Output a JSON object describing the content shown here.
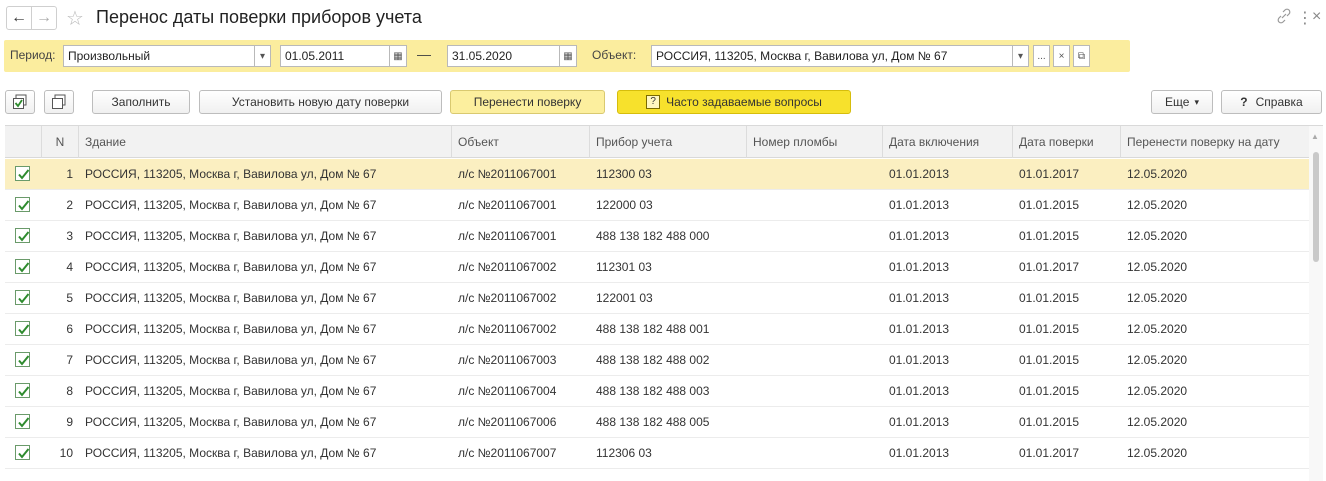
{
  "window": {
    "title": "Перенос даты поверки приборов учета",
    "back_icon": "←",
    "forward_icon": "→",
    "star_icon": "☆",
    "link_icon": "🔗",
    "more_icon": "⋮",
    "close_icon": "×"
  },
  "filters": {
    "period_label": "Период:",
    "period_value": "Произвольный",
    "date_from": "01.05.2011",
    "dash": "—",
    "date_to": "31.05.2020",
    "object_label": "Объект:",
    "object_value": "РОССИЯ, 113205, Москва г, Вавилова ул, Дом № 67",
    "dropdown_glyph": "▾",
    "ellipsis_glyph": "...",
    "clear_glyph": "×",
    "open_glyph": "⧉",
    "calendar_glyph": "▦"
  },
  "toolbar": {
    "fill_label": "Заполнить",
    "set_date_label": "Установить новую дату поверки",
    "move_label": "Перенести поверку",
    "faq_label": "Часто задаваемые вопросы",
    "faq_badge": "?",
    "more_label": "Еще",
    "more_arrow": "▾",
    "help_label": "Справка",
    "help_badge": "?"
  },
  "table": {
    "columns": [
      "",
      "N",
      "Здание",
      "Объект",
      "Прибор учета",
      "Номер пломбы",
      "Дата включения",
      "Дата поверки",
      "Перенести поверку на дату"
    ],
    "rows": [
      {
        "n": "1",
        "building": "РОССИЯ, 113205, Москва г, Вавилова ул, Дом № 67",
        "object": "л/с №2011067001",
        "meter": "112300 03",
        "seal": "",
        "on_date": "01.01.2013",
        "check_date": "01.01.2017",
        "new_date": "12.05.2020"
      },
      {
        "n": "2",
        "building": "РОССИЯ, 113205, Москва г, Вавилова ул, Дом № 67",
        "object": "л/с №2011067001",
        "meter": "122000 03",
        "seal": "",
        "on_date": "01.01.2013",
        "check_date": "01.01.2015",
        "new_date": "12.05.2020"
      },
      {
        "n": "3",
        "building": "РОССИЯ, 113205, Москва г, Вавилова ул, Дом № 67",
        "object": "л/с №2011067001",
        "meter": "488 138 182 488 000",
        "seal": "",
        "on_date": "01.01.2013",
        "check_date": "01.01.2015",
        "new_date": "12.05.2020"
      },
      {
        "n": "4",
        "building": "РОССИЯ, 113205, Москва г, Вавилова ул, Дом № 67",
        "object": "л/с №2011067002",
        "meter": "112301 03",
        "seal": "",
        "on_date": "01.01.2013",
        "check_date": "01.01.2017",
        "new_date": "12.05.2020"
      },
      {
        "n": "5",
        "building": "РОССИЯ, 113205, Москва г, Вавилова ул, Дом № 67",
        "object": "л/с №2011067002",
        "meter": "122001 03",
        "seal": "",
        "on_date": "01.01.2013",
        "check_date": "01.01.2015",
        "new_date": "12.05.2020"
      },
      {
        "n": "6",
        "building": "РОССИЯ, 113205, Москва г, Вавилова ул, Дом № 67",
        "object": "л/с №2011067002",
        "meter": "488 138 182 488 001",
        "seal": "",
        "on_date": "01.01.2013",
        "check_date": "01.01.2015",
        "new_date": "12.05.2020"
      },
      {
        "n": "7",
        "building": "РОССИЯ, 113205, Москва г, Вавилова ул, Дом № 67",
        "object": "л/с №2011067003",
        "meter": "488 138 182 488 002",
        "seal": "",
        "on_date": "01.01.2013",
        "check_date": "01.01.2015",
        "new_date": "12.05.2020"
      },
      {
        "n": "8",
        "building": "РОССИЯ, 113205, Москва г, Вавилова ул, Дом № 67",
        "object": "л/с №2011067004",
        "meter": "488 138 182 488 003",
        "seal": "",
        "on_date": "01.01.2013",
        "check_date": "01.01.2015",
        "new_date": "12.05.2020"
      },
      {
        "n": "9",
        "building": "РОССИЯ, 113205, Москва г, Вавилова ул, Дом № 67",
        "object": "л/с №2011067006",
        "meter": "488 138 182 488 005",
        "seal": "",
        "on_date": "01.01.2013",
        "check_date": "01.01.2015",
        "new_date": "12.05.2020"
      },
      {
        "n": "10",
        "building": "РОССИЯ, 113205, Москва г, Вавилова ул, Дом № 67",
        "object": "л/с №2011067007",
        "meter": "112306 03",
        "seal": "",
        "on_date": "01.01.2013",
        "check_date": "01.01.2017",
        "new_date": "12.05.2020"
      }
    ],
    "selected_row": 0,
    "scroll_up_glyph": "▲"
  },
  "colors": {
    "filter_bg": "#fbed9e",
    "faq_bg": "#f7e12c",
    "selected_row": "#fbefc1",
    "check_green": "#2e8b2e"
  }
}
